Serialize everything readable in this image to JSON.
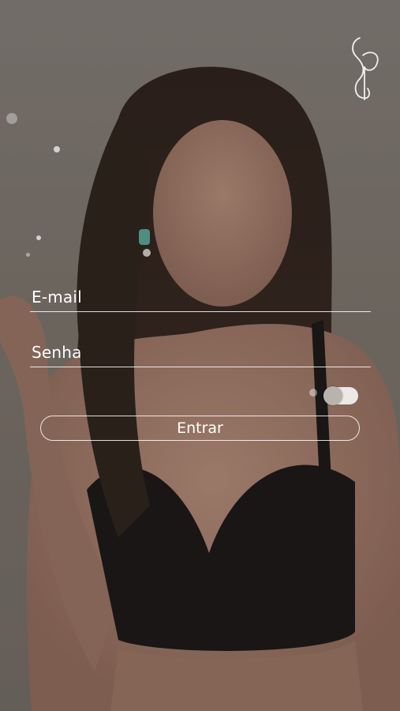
{
  "login": {
    "email_placeholder": "E-mail",
    "password_placeholder": "Senha",
    "submit_label": "Entrar",
    "remember_toggle_on": false
  },
  "theme": {
    "text_color": "#ffffff",
    "overlay_color": "#3a322d"
  },
  "icons": {
    "brand_logo": "script-monogram-logo"
  }
}
